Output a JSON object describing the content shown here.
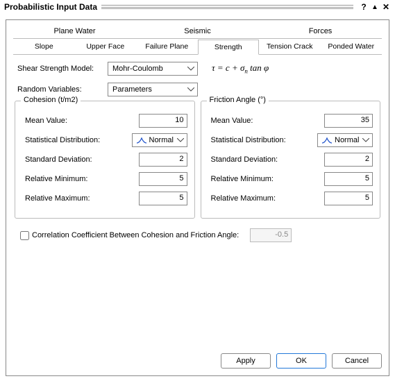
{
  "window": {
    "title": "Probabilistic Input Data",
    "help_glyph": "?",
    "collapse_glyph": "▲",
    "close_glyph": "✕"
  },
  "tabs_row1": [
    "Plane Water",
    "Seismic",
    "Forces"
  ],
  "tabs_row2": [
    "Slope",
    "Upper Face",
    "Failure Plane",
    "Strength",
    "Tension Crack",
    "Ponded Water"
  ],
  "active_tab_row2": 3,
  "form": {
    "shear_model_label": "Shear Strength Model:",
    "shear_model_value": "Mohr-Coulomb",
    "random_label": "Random Variables:",
    "random_value": "Parameters"
  },
  "equation_display": "τ = c + σₙ tan φ",
  "cohesion": {
    "legend": "Cohesion (t/m2)",
    "mean_label": "Mean Value:",
    "mean_value": "10",
    "dist_label": "Statistical Distribution:",
    "dist_value": "Normal",
    "std_label": "Standard Deviation:",
    "std_value": "2",
    "relmin_label": "Relative Minimum:",
    "relmin_value": "5",
    "relmax_label": "Relative Maximum:",
    "relmax_value": "5"
  },
  "friction": {
    "legend": "Friction Angle (°)",
    "mean_label": "Mean Value:",
    "mean_value": "35",
    "dist_label": "Statistical Distribution:",
    "dist_value": "Normal",
    "std_label": "Standard Deviation:",
    "std_value": "2",
    "relmin_label": "Relative Minimum:",
    "relmin_value": "5",
    "relmax_label": "Relative Maximum:",
    "relmax_value": "5"
  },
  "corr": {
    "label": "Correlation Coefficient Between Cohesion and Friction Angle:",
    "value": "-0.5",
    "checked": false
  },
  "buttons": {
    "apply": "Apply",
    "ok": "OK",
    "cancel": "Cancel"
  }
}
